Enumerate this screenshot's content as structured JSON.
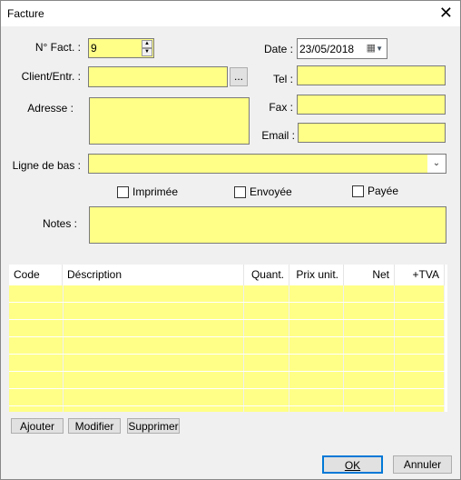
{
  "window": {
    "title": "Facture",
    "close_icon": "close-icon"
  },
  "form": {
    "num_label": "N° Fact. :",
    "num_value": "9",
    "client_label": "Client/Entr. :",
    "client_value": "",
    "browse_label": "...",
    "adresse_label": "Adresse :",
    "adresse_value": "",
    "date_label": "Date :",
    "date_value": "23/05/2018",
    "tel_label": "Tel :",
    "tel_value": "",
    "fax_label": "Fax :",
    "fax_value": "",
    "email_label": "Email :",
    "email_value": "",
    "ligne_label": "Ligne de bas :",
    "ligne_value": "",
    "notes_label": "Notes :",
    "notes_value": ""
  },
  "checkboxes": [
    {
      "label": "Imprimée",
      "checked": false
    },
    {
      "label": "Envoyée",
      "checked": false
    },
    {
      "label": "Payée",
      "checked": false
    }
  ],
  "table": {
    "columns": [
      "Code",
      "Déscription",
      "Quant.",
      "Prix unit.",
      "Net",
      "+TVA"
    ],
    "rows": []
  },
  "actions": {
    "add": "Ajouter",
    "edit": "Modifier",
    "delete": "Supprimer"
  },
  "footer": {
    "ok": "OK",
    "cancel": "Annuler"
  },
  "colors": {
    "field": "#ffff88",
    "accent": "#0078d7"
  }
}
